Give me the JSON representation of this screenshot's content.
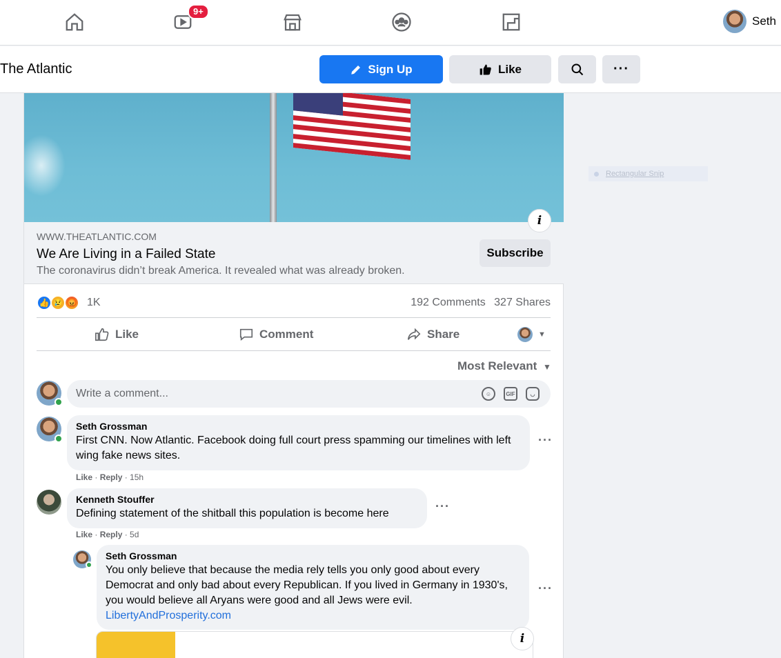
{
  "nav": {
    "watch_badge": "9+",
    "profile_name": "Seth"
  },
  "page": {
    "title": "The Atlantic",
    "signup_label": "Sign Up",
    "like_label": "Like"
  },
  "post": {
    "link_domain": "WWW.THEATLANTIC.COM",
    "link_title": "We Are Living in a Failed State",
    "link_subtitle": "The coronavirus didn’t break America. It revealed what was already broken.",
    "subscribe_label": "Subscribe",
    "reaction_count": "1K",
    "comments_count": "192 Comments",
    "shares_count": "327 Shares",
    "actions": {
      "like": "Like",
      "comment": "Comment",
      "share": "Share"
    },
    "sort_label": "Most Relevant",
    "write_placeholder": "Write a comment..."
  },
  "comments": [
    {
      "author": "Seth Grossman",
      "text": "First CNN. Now Atlantic. Facebook doing full court press spamming our timelines with left wing fake news sites.",
      "like": "Like",
      "reply": "Reply",
      "time": "· 15h"
    },
    {
      "author": "Kenneth Stouffer",
      "text": "Defining statement of the shitball this population is become here",
      "like": "Like",
      "reply": "Reply",
      "time": "· 5d"
    },
    {
      "author": "Seth Grossman",
      "text": "You only believe that because the media rely tells you only good about every Democrat and only bad about every Republican. If you lived in Germany in 1930's, you would believe all Aryans were good and all Jews were evil.",
      "link": "LibertyAndProsperity.com"
    }
  ],
  "overlay": {
    "snip_label": "Rectangular Snip"
  },
  "colors": {
    "accent": "#1877f2",
    "badge": "#e41e3f",
    "link": "#216fdb",
    "online": "#31a24c"
  }
}
